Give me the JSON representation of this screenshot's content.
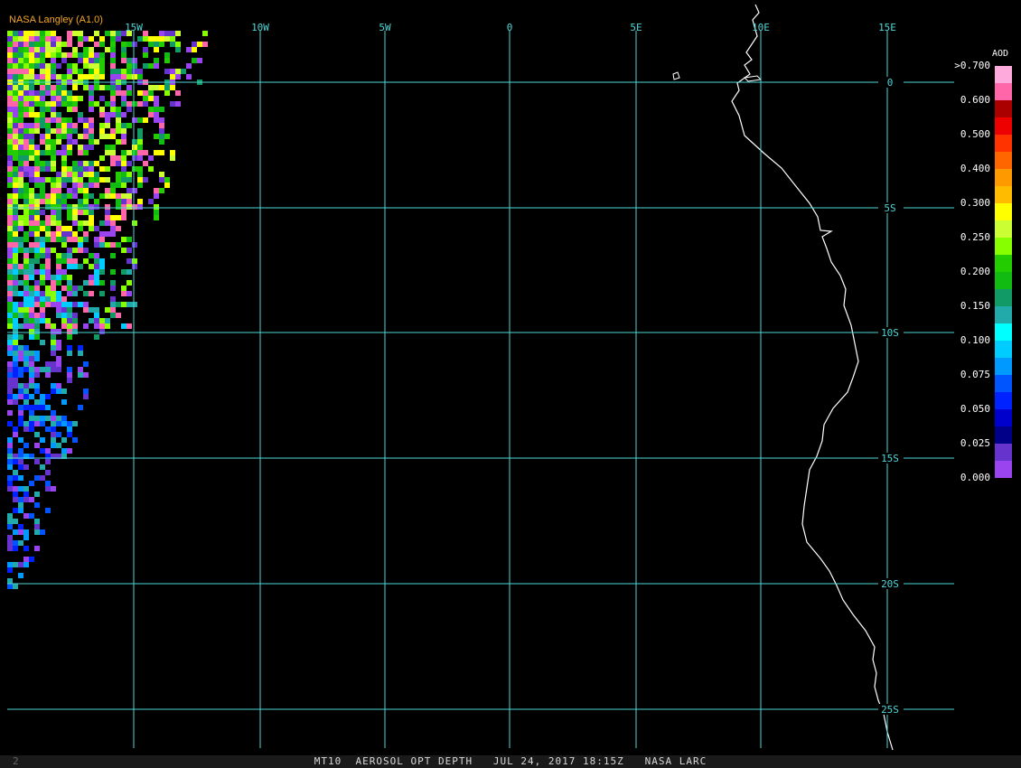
{
  "brand": "NASA Langley (A1.0)",
  "status_bar": {
    "left": "2",
    "center": "MT10  AEROSOL OPT DEPTH   JUL 24, 2017 18:15Z   NASA LARC"
  },
  "map": {
    "longitude_labels": [
      "15W",
      "10W",
      "5W",
      "0",
      "5E",
      "10E",
      "15E"
    ],
    "latitude_labels": [
      "0",
      "5S",
      "10S",
      "15S",
      "20S",
      "25S"
    ],
    "grid_color": "#4fd6d6",
    "coastline_color": "#ffffff"
  },
  "legend": {
    "title": "AOD",
    "labels": [
      ">0.700",
      "0.600",
      "0.500",
      "0.400",
      "0.300",
      "0.250",
      "0.200",
      "0.150",
      "0.100",
      "0.075",
      "0.050",
      "0.025",
      "0.000"
    ],
    "colors": [
      "#ffaadd",
      "#ff66aa",
      "#aa0000",
      "#ee0000",
      "#ff3300",
      "#ff6600",
      "#ff9900",
      "#ffbb00",
      "#ffff00",
      "#ccff33",
      "#88ff00",
      "#22cc00",
      "#11bb11",
      "#119966",
      "#22aaaa",
      "#00ffff",
      "#00ccff",
      "#0099ff",
      "#0055ff",
      "#0022ff",
      "#0000cc",
      "#000088",
      "#6633cc",
      "#9944ee"
    ]
  }
}
